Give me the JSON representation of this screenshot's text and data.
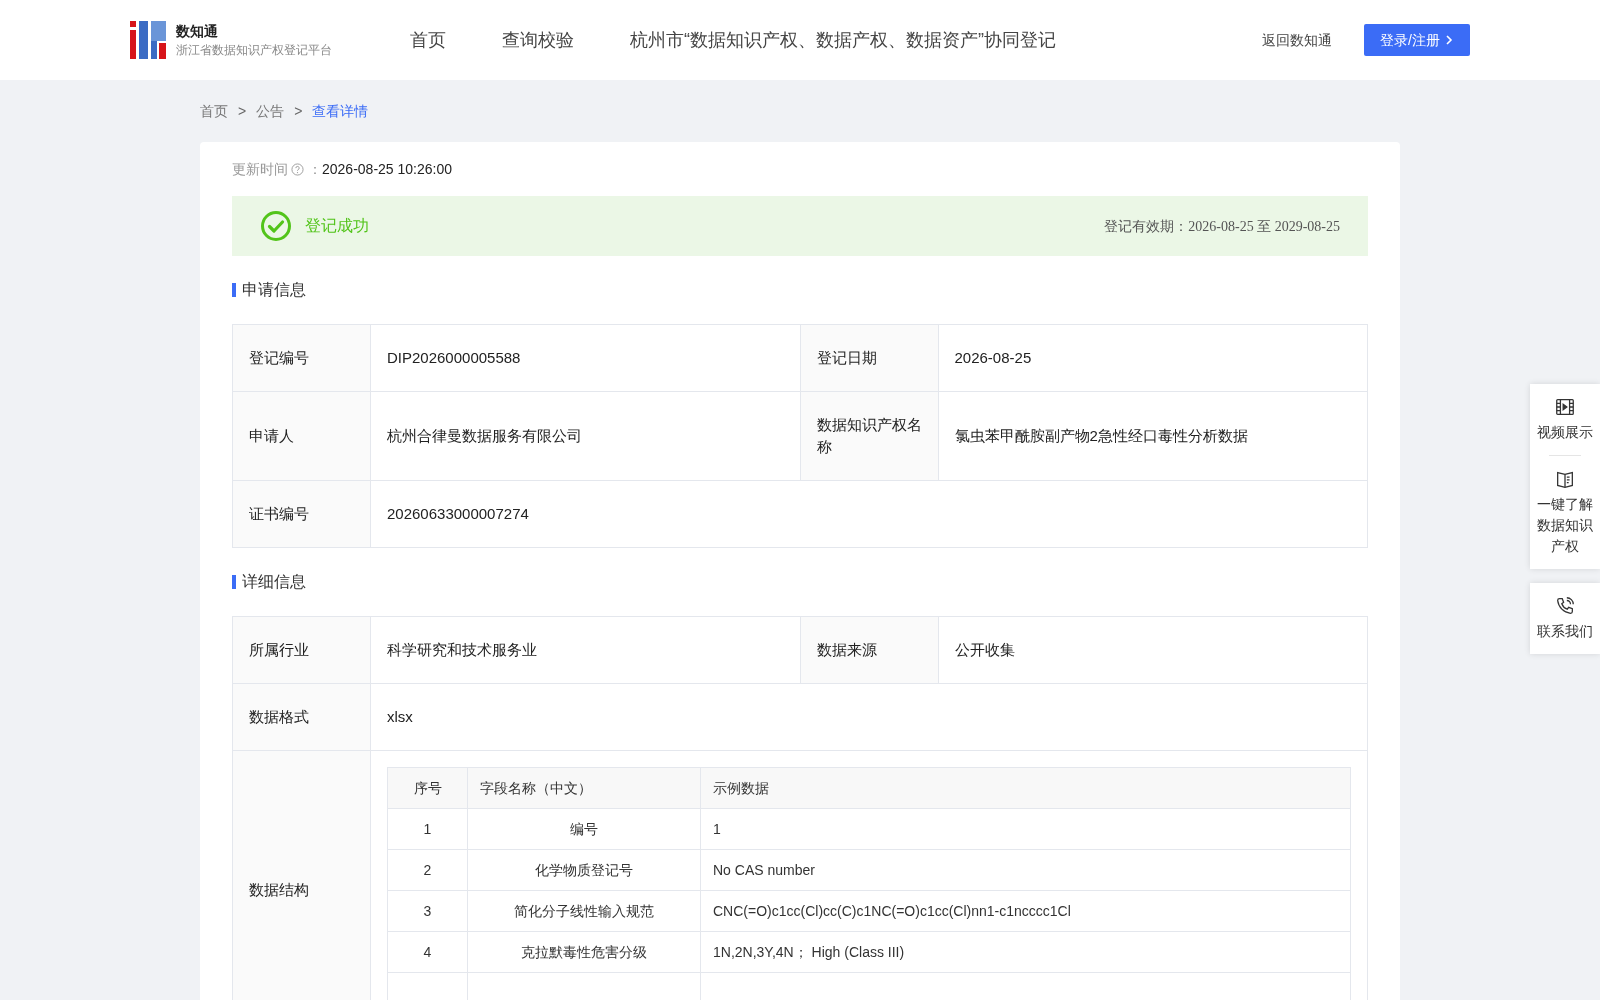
{
  "header": {
    "logo_title": "数知通",
    "logo_subtitle": "浙江省数据知识产权登记平台",
    "nav": [
      {
        "label": "首页"
      },
      {
        "label": "查询校验"
      },
      {
        "label": "杭州市“数据知识产权、数据产权、数据资产”协同登记"
      }
    ],
    "back_link": "返回数知通",
    "login_button": "登录/注册"
  },
  "breadcrumb": [
    {
      "label": "首页",
      "selected": false
    },
    {
      "label": "公告",
      "selected": false
    },
    {
      "label": "查看详情",
      "selected": true
    }
  ],
  "breadcrumb_separator": ">",
  "update": {
    "label": "更新时间",
    "separator": "：",
    "value": "2026-08-25 10:26:00"
  },
  "status": {
    "kind": "success",
    "text": "登记成功",
    "validity": "登记有效期：2026-08-25 至 2029-08-25"
  },
  "application": {
    "title": "申请信息",
    "rows": [
      [
        {
          "label": "登记编号",
          "value": "DIP2026000005588"
        },
        {
          "label": "登记日期",
          "value": "2026-08-25"
        }
      ],
      [
        {
          "label": "申请人",
          "value": "杭州合律曼数据服务有限公司"
        },
        {
          "label": "数据知识产权名称",
          "value": "氯虫苯甲酰胺副产物2急性经口毒性分析数据"
        }
      ],
      [
        {
          "label": "证书编号",
          "value": "20260633000007274"
        }
      ]
    ]
  },
  "details": {
    "title": "详细信息",
    "rows": [
      [
        {
          "label": "所属行业",
          "value": "科学研究和技术服务业"
        },
        {
          "label": "数据来源",
          "value": "公开收集"
        }
      ],
      [
        {
          "label": "数据格式",
          "value": "xlsx"
        }
      ]
    ],
    "structure": {
      "label": "数据结构",
      "columns": [
        "序号",
        "字段名称（中文）",
        "示例数据"
      ],
      "rows": [
        [
          "1",
          "编号",
          "1"
        ],
        [
          "2",
          "化学物质登记号",
          "No CAS number"
        ],
        [
          "3",
          "简化分子线性输入规范",
          "CNC(=O)c1cc(Cl)cc(C)c1NC(=O)c1cc(Cl)nn1-c1ncccc1Cl"
        ],
        [
          "4",
          "克拉默毒性危害分级",
          "1N,2N,3Y,4N； High (Class III)"
        ]
      ]
    }
  },
  "side_panel": [
    {
      "kind": "video",
      "label": "视频展示"
    },
    {
      "kind": "book",
      "label": "一键了解数据知识产权"
    },
    {
      "kind": "phone",
      "label": "联系我们"
    }
  ]
}
